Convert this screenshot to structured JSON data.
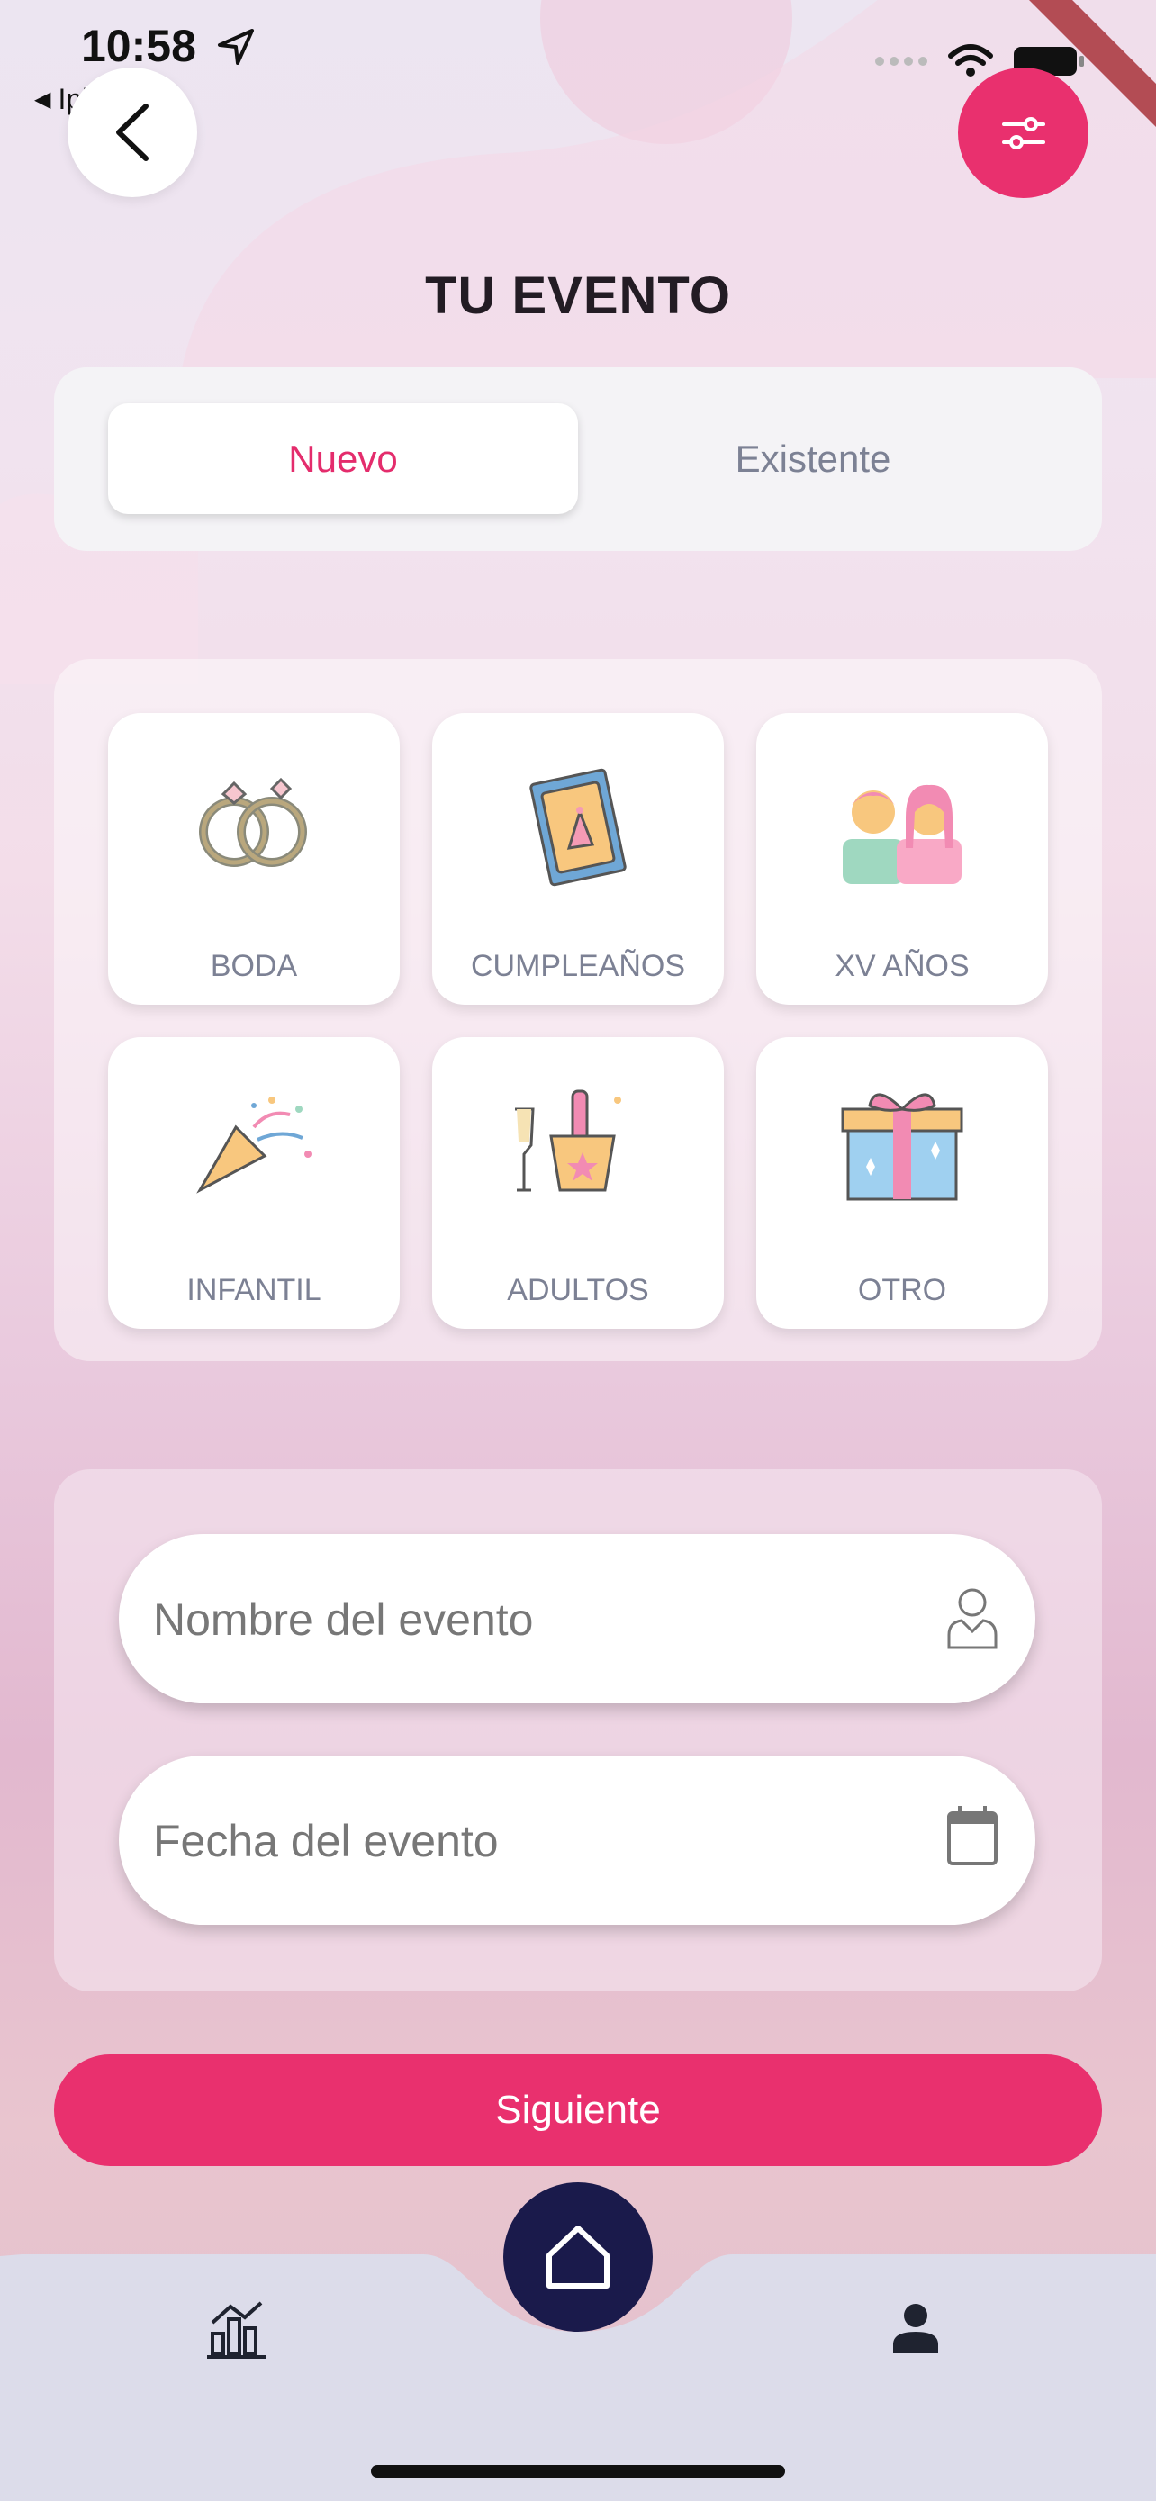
{
  "status_bar": {
    "time": "10:58",
    "back_app_label": "Iplanner"
  },
  "header": {
    "title": "TU EVENTO",
    "back_icon": "chevron-left-icon",
    "filter_icon": "sliders-icon"
  },
  "segment": {
    "active": "Nuevo",
    "inactive": "Existente"
  },
  "event_types": [
    {
      "label": "BODA",
      "icon": "rings-icon"
    },
    {
      "label": "CUMPLEAÑOS",
      "icon": "birthday-card-icon"
    },
    {
      "label": "XV AÑOS",
      "icon": "couple-icon"
    },
    {
      "label": "INFANTIL",
      "icon": "party-popper-icon"
    },
    {
      "label": "ADULTOS",
      "icon": "champagne-bucket-icon"
    },
    {
      "label": "OTRO",
      "icon": "gift-box-icon"
    }
  ],
  "form": {
    "name_placeholder": "Nombre del evento",
    "name_value": "",
    "date_placeholder": "Fecha del evento",
    "date_value": ""
  },
  "buttons": {
    "next": "Siguiente"
  },
  "nav": {
    "items": [
      "stats-icon",
      "home-icon",
      "profile-icon"
    ]
  },
  "colors": {
    "accent": "#e9306e",
    "nav_dark": "#1a1a4b",
    "muted_text": "#7c8194"
  }
}
